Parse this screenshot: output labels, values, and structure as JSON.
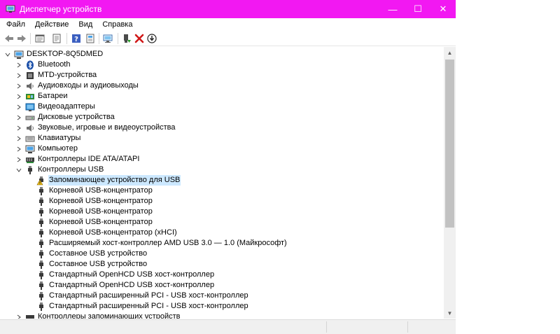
{
  "window": {
    "title": "Диспетчер устройств",
    "controls": {
      "minimize": "—",
      "maximize": "☐",
      "close": "✕"
    },
    "accent": "#f218f2"
  },
  "menu": [
    "Файл",
    "Действие",
    "Вид",
    "Справка"
  ],
  "toolbar": {
    "buttons": [
      "back-icon",
      "forward-icon",
      "properties-icon",
      "device-list-icon",
      "help-icon",
      "view-icon",
      "scan-hardware-icon",
      "update-driver-icon",
      "uninstall-icon",
      "disable-device-icon"
    ]
  },
  "tree": {
    "root": "DESKTOP-8Q5DMED",
    "categories": [
      {
        "label": "Bluetooth",
        "icon": "bluetooth-icon"
      },
      {
        "label": "MTD-устройства",
        "icon": "mtd-device-icon"
      },
      {
        "label": "Аудиовходы и аудиовыходы",
        "icon": "audio-io-icon"
      },
      {
        "label": "Батареи",
        "icon": "battery-icon"
      },
      {
        "label": "Видеоадаптеры",
        "icon": "display-adapter-icon"
      },
      {
        "label": "Дисковые устройства",
        "icon": "disk-drive-icon"
      },
      {
        "label": "Звуковые, игровые и видеоустройства",
        "icon": "sound-device-icon"
      },
      {
        "label": "Клавиатуры",
        "icon": "keyboard-icon"
      },
      {
        "label": "Компьютер",
        "icon": "computer-icon"
      },
      {
        "label": "Контроллеры IDE ATA/ATAPI",
        "icon": "ide-controller-icon"
      },
      {
        "label": "Контроллеры USB",
        "icon": "usb-icon",
        "expanded": true
      }
    ],
    "usb_children": [
      {
        "label": "Запоминающее устройство для USB",
        "icon": "warning-usb-icon",
        "selected": true
      },
      {
        "label": "Корневой USB-концентратор"
      },
      {
        "label": "Корневой USB-концентратор"
      },
      {
        "label": "Корневой USB-концентратор"
      },
      {
        "label": "Корневой USB-концентратор"
      },
      {
        "label": "Корневой USB-концентратор (xHCI)"
      },
      {
        "label": "Расширяемый хост-контроллер AMD USB 3.0 — 1.0 (Майкрософт)"
      },
      {
        "label": "Составное USB устройство"
      },
      {
        "label": "Составное USB устройство"
      },
      {
        "label": "Стандартный OpenHCD USB хост-контроллер"
      },
      {
        "label": "Стандартный OpenHCD USB хост-контроллер"
      },
      {
        "label": "Стандартный расширенный PCI - USB хост-контроллер"
      },
      {
        "label": "Стандартный расширенный PCI - USB хост-контроллер"
      }
    ],
    "after": [
      {
        "label": "Контроллеры запоминающих устройств",
        "icon": "storage-controller-icon"
      }
    ]
  }
}
